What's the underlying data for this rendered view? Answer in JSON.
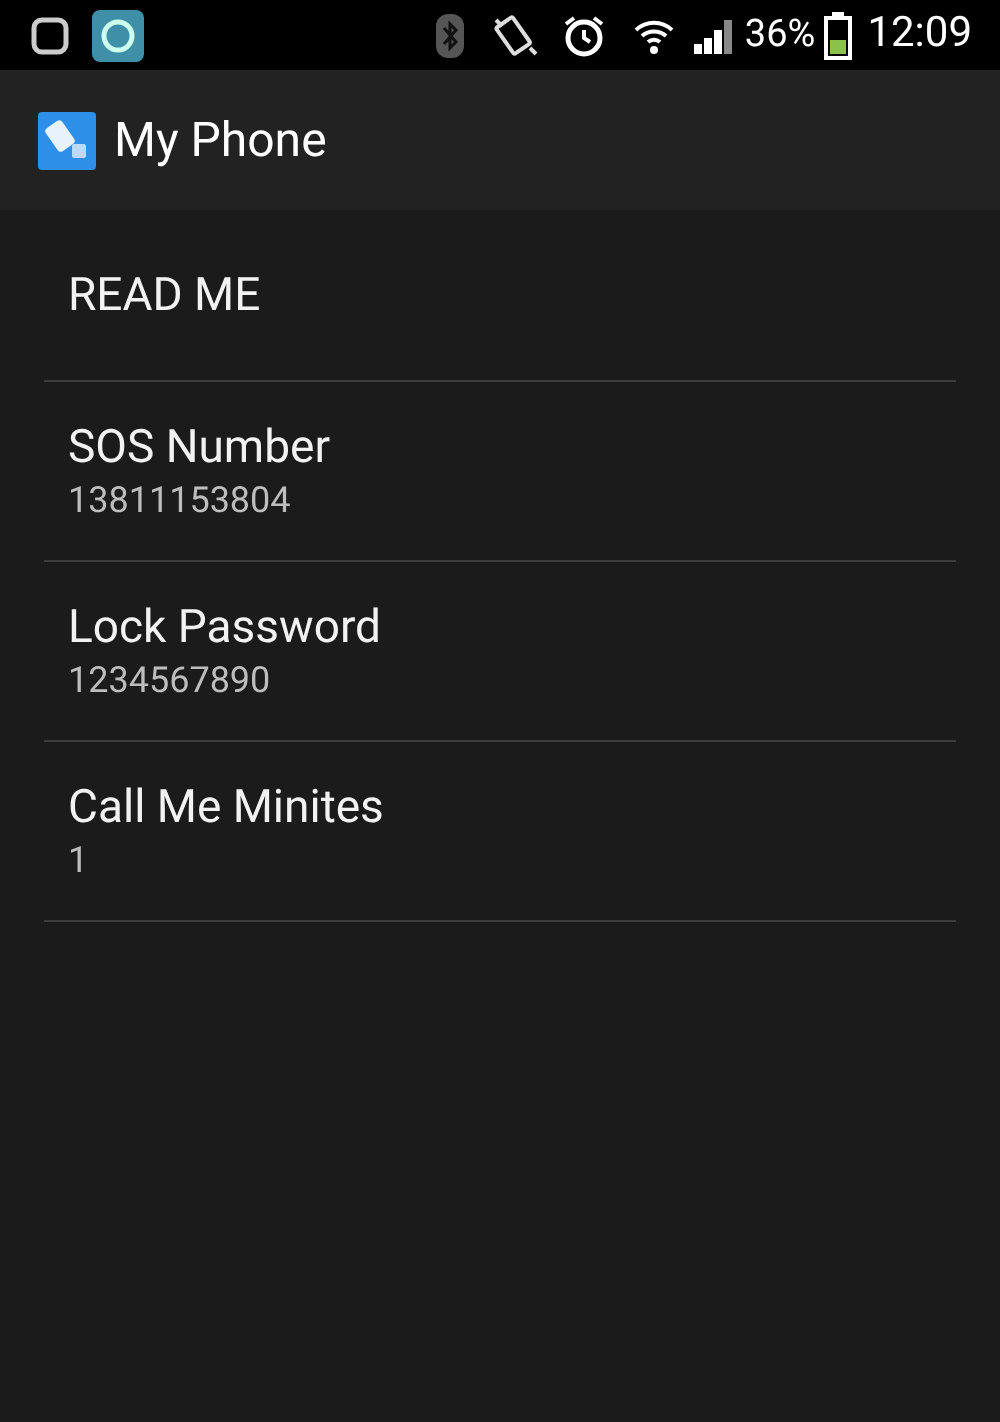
{
  "status_bar": {
    "battery_text": "36%",
    "time": "12:09"
  },
  "action_bar": {
    "title": "My Phone"
  },
  "preferences": [
    {
      "title": "READ ME"
    },
    {
      "title": "SOS Number",
      "summary": "13811153804"
    },
    {
      "title": "Lock Password",
      "summary": "1234567890"
    },
    {
      "title": "Call Me Minites",
      "summary": "1"
    }
  ]
}
